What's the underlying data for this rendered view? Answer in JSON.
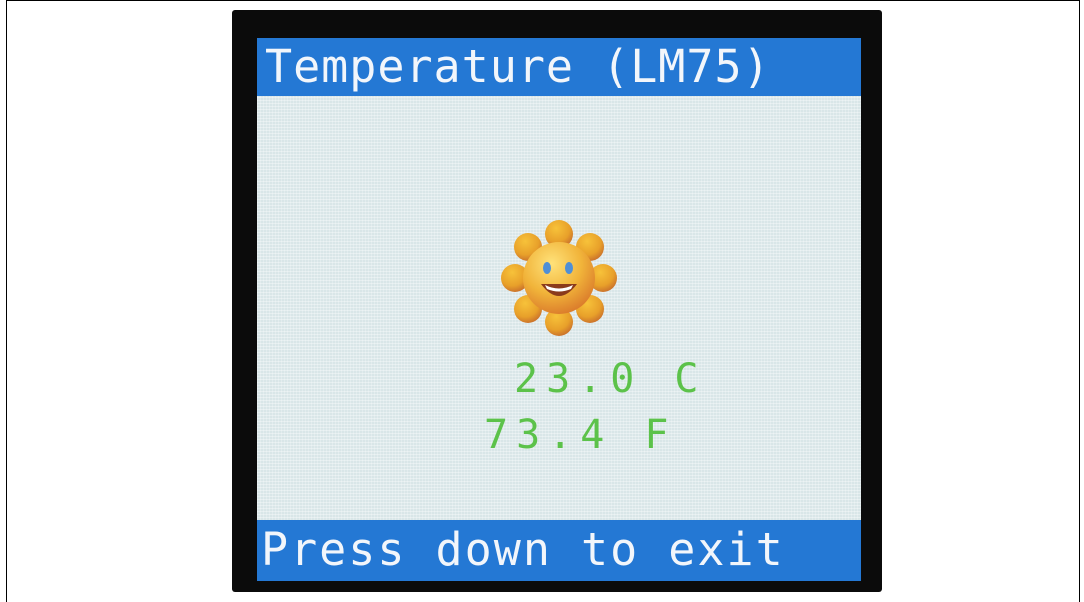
{
  "screen": {
    "title": "Temperature (LM75)",
    "footer_hint": "Press down to exit"
  },
  "readings": {
    "celsius": "23.0 C",
    "fahrenheit": "73.4 F"
  },
  "icons": {
    "status_icon": "smiling-sun-icon"
  },
  "colors": {
    "bar_background": "#2478d4",
    "bar_text": "#f2f6fb",
    "screen_background": "#d9e6e8",
    "reading_text": "#5cc24a",
    "bezel": "#0b0b0b"
  }
}
